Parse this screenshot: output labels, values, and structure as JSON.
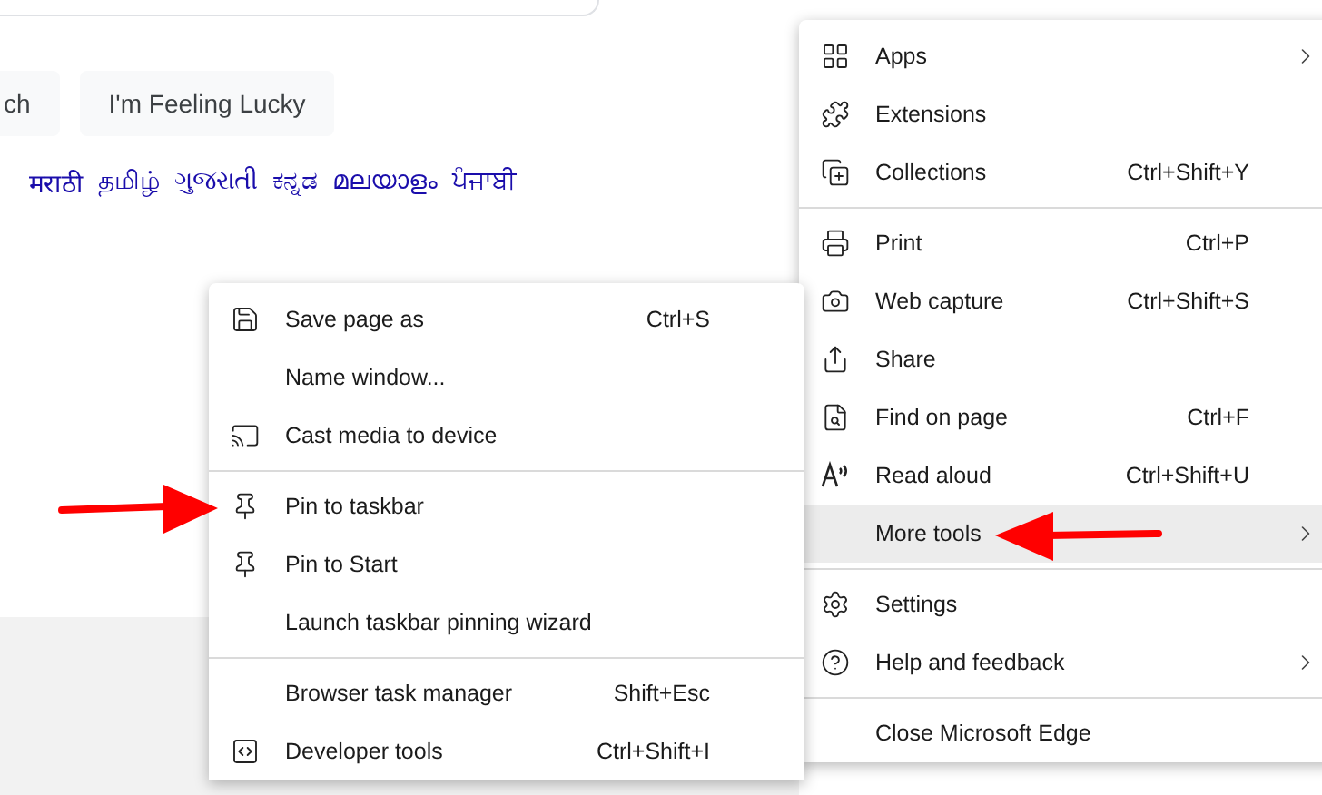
{
  "page": {
    "buttons": [
      "ch",
      "I'm Feeling Lucky"
    ],
    "languages": [
      "मराठी",
      "தமிழ்",
      "ગુજરાતી",
      "ಕನ್ನಡ",
      "മലയാളം",
      "ਪੰਜਾਬੀ"
    ]
  },
  "main_menu": {
    "groups": [
      [
        {
          "label": "Apps",
          "submenu": true,
          "selected": false
        },
        {
          "label": "Extensions",
          "submenu": false,
          "selected": false
        },
        {
          "label": "Collections",
          "shortcut": "Ctrl+Shift+Y",
          "submenu": false,
          "selected": false
        }
      ],
      [
        {
          "label": "Print",
          "shortcut": "Ctrl+P",
          "submenu": false,
          "selected": false
        },
        {
          "label": "Web capture",
          "shortcut": "Ctrl+Shift+S",
          "submenu": false,
          "selected": false
        },
        {
          "label": "Share",
          "submenu": false,
          "selected": false
        },
        {
          "label": "Find on page",
          "shortcut": "Ctrl+F",
          "submenu": false,
          "selected": false
        },
        {
          "label": "Read aloud",
          "shortcut": "Ctrl+Shift+U",
          "submenu": false,
          "selected": false
        },
        {
          "label": "More tools",
          "submenu": true,
          "selected": true
        }
      ],
      [
        {
          "label": "Settings",
          "submenu": false,
          "selected": false
        },
        {
          "label": "Help and feedback",
          "submenu": true,
          "selected": false
        }
      ],
      [
        {
          "label": "Close Microsoft Edge",
          "submenu": false,
          "selected": false
        }
      ]
    ]
  },
  "more_tools_menu": {
    "groups": [
      [
        {
          "label": "Save page as",
          "shortcut": "Ctrl+S"
        },
        {
          "label": "Name window..."
        },
        {
          "label": "Cast media to device"
        }
      ],
      [
        {
          "label": "Pin to taskbar"
        },
        {
          "label": "Pin to Start"
        },
        {
          "label": "Launch taskbar pinning wizard"
        }
      ],
      [
        {
          "label": "Browser task manager",
          "shortcut": "Shift+Esc"
        },
        {
          "label": "Developer tools",
          "shortcut": "Ctrl+Shift+I"
        }
      ]
    ]
  }
}
